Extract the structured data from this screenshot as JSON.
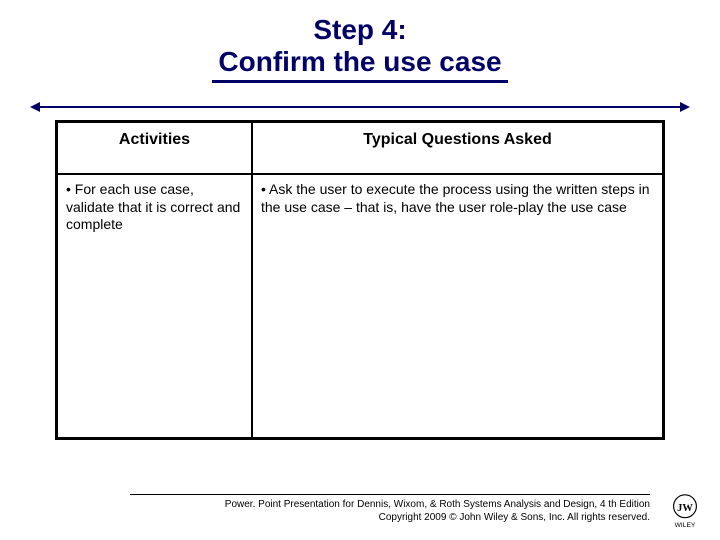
{
  "title": {
    "line1": "Step 4:",
    "line2": "Confirm the use case"
  },
  "table": {
    "headers": {
      "activities": "Activities",
      "questions": "Typical Questions Asked"
    },
    "cells": {
      "activities_body": "• For each use case, validate that it is correct and complete",
      "questions_body": "• Ask the user to execute the process using the written steps in the use case – that is, have the user role-play the use case"
    }
  },
  "footer": {
    "line1": "Power. Point Presentation for Dennis, Wixom, & Roth Systems Analysis and Design, 4 th Edition",
    "line2": "Copyright 2009 © John Wiley & Sons, Inc.  All rights reserved."
  },
  "logo_label": "WILEY"
}
